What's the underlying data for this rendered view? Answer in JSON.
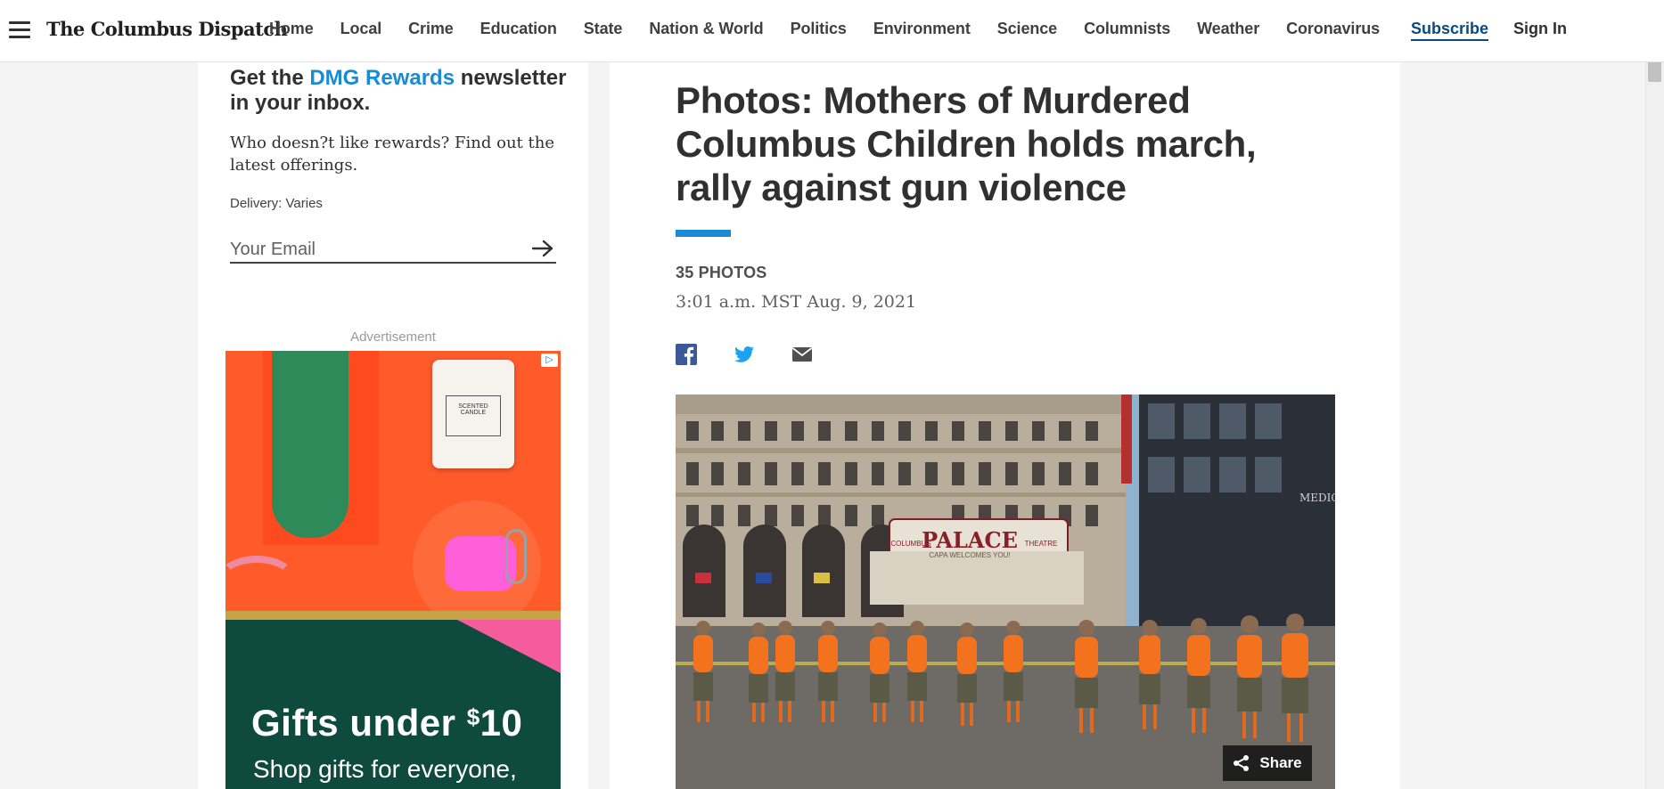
{
  "header": {
    "brand": "The Columbus Dispatch",
    "nav": [
      "Home",
      "Local",
      "Crime",
      "Education",
      "State",
      "Nation & World",
      "Politics",
      "Environment",
      "Science",
      "Columnists",
      "Weather",
      "Coronavirus"
    ],
    "subscribe": "Subscribe",
    "sign_in": "Sign In"
  },
  "newsletter": {
    "title_prefix": "Get the ",
    "title_accent": "DMG Rewards",
    "title_suffix": " newsletter in your inbox.",
    "description": "Who doesn?t like rewards? Find out the latest offerings.",
    "delivery": "Delivery: Varies",
    "email_placeholder": "Your Email"
  },
  "advertisement": {
    "label": "Advertisement",
    "candle_text": "SCENTED CANDLE",
    "headline": "Gifts under ",
    "headline_currency": "$",
    "headline_amount": "10",
    "subline": "Shop gifts for everyone,"
  },
  "article": {
    "headline": "Photos: Mothers of Murdered Columbus Children holds march, rally against gun violence",
    "photo_count": "35 PHOTOS",
    "timestamp": "3:01 a.m. MST Aug. 9, 2021",
    "share_label": "Share",
    "photo_signs": {
      "marquee": "PALACE",
      "marquee_left": "COLUMBUS",
      "marquee_right": "THEATRE",
      "marquee_sub": "CAPA WELCOMES YOU!",
      "building_sign": "MEDIC"
    }
  },
  "colors": {
    "accent": "#1a8ad4",
    "facebook": "#3b5998",
    "twitter": "#1da1f2",
    "shirt_orange": "#f2721e"
  }
}
